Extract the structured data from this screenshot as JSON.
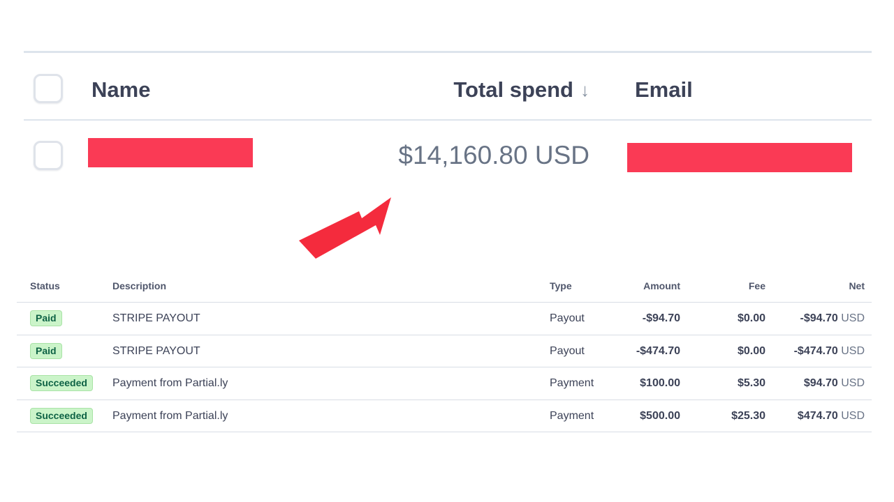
{
  "customer_table": {
    "columns": {
      "name": "Name",
      "total_spend": "Total spend",
      "sort_arrow": "↓",
      "email": "Email"
    },
    "row": {
      "total_spend": "$14,160.80 USD"
    },
    "colors": {
      "redaction": "#fa3a55",
      "arrow": "#f42b3d"
    }
  },
  "balance_table": {
    "columns": {
      "status": "Status",
      "description": "Description",
      "type": "Type",
      "amount": "Amount",
      "fee": "Fee",
      "net": "Net"
    },
    "rows": [
      {
        "status": "Paid",
        "description": "STRIPE PAYOUT",
        "type": "Payout",
        "amount": "-$94.70",
        "fee": "$0.00",
        "net": "-$94.70",
        "currency": "USD"
      },
      {
        "status": "Paid",
        "description": "STRIPE PAYOUT",
        "type": "Payout",
        "amount": "-$474.70",
        "fee": "$0.00",
        "net": "-$474.70",
        "currency": "USD"
      },
      {
        "status": "Succeeded",
        "description": "Payment from Partial.ly",
        "type": "Payment",
        "amount": "$100.00",
        "fee": "$5.30",
        "net": "$94.70",
        "currency": "USD"
      },
      {
        "status": "Succeeded",
        "description": "Payment from Partial.ly",
        "type": "Payment",
        "amount": "$500.00",
        "fee": "$25.30",
        "net": "$474.70",
        "currency": "USD"
      }
    ],
    "colors": {
      "badge_text": "#0e6245",
      "badge_bg": "#cbf4c9"
    }
  }
}
